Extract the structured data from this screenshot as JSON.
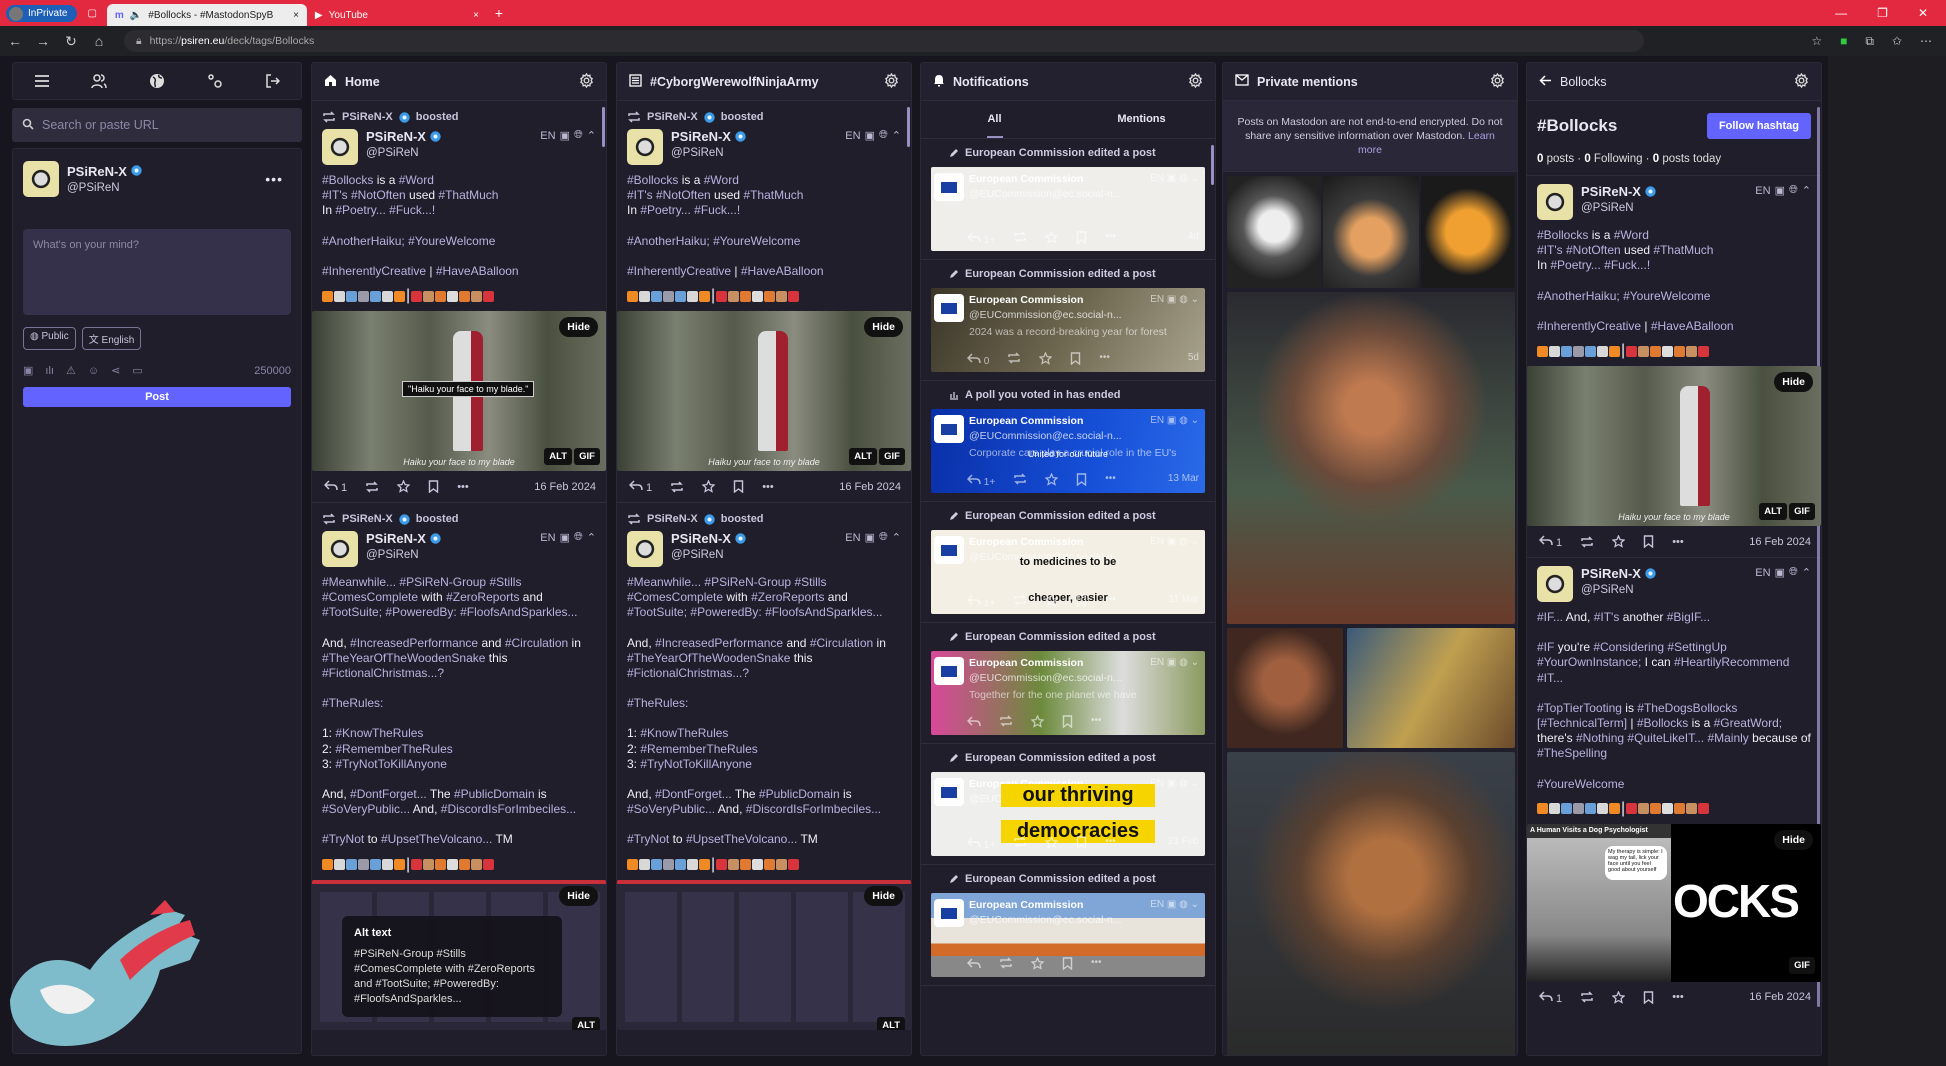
{
  "browser": {
    "inprivate": "InPrivate",
    "tabs": [
      {
        "title": "#Bollocks - #MastodonSpyB",
        "close": "×"
      },
      {
        "title": "YouTube",
        "close": "×"
      }
    ],
    "new_tab": "+",
    "url_prefix": "https://",
    "url_domain": "psiren.eu",
    "url_path": "/deck/tags/Bollocks"
  },
  "sidebar": {
    "search_placeholder": "Search or paste URL",
    "profile": {
      "name": "PSiReN-X",
      "handle": "@PSiReN"
    },
    "compose": {
      "placeholder": "What's on your mind?",
      "visibility": "Public",
      "language": "English",
      "counter": "250000",
      "post": "Post"
    }
  },
  "colors": {
    "accent": "#6364ff",
    "hashtag": "#b9b2e0",
    "titlebar": "#e3293f"
  },
  "columns": {
    "home": {
      "title": "Home"
    },
    "cyborg": {
      "title": "#CyborgWerewolfNinjaArmy"
    },
    "notifications": {
      "title": "Notifications",
      "tabs": [
        "All",
        "Mentions"
      ],
      "items": [
        {
          "label": "European Commission edited a post",
          "icon": "pencil-icon",
          "name": "European Commission",
          "handle": "@EUCommission@ec.social-n...",
          "excerpt": "",
          "meta": "EN",
          "replies": "1+",
          "date": "4d",
          "bg": "#efeeea",
          "overlay": []
        },
        {
          "label": "European Commission edited a post",
          "icon": "pencil-icon",
          "name": "European Commission",
          "handle": "@EUCommission@ec.social-n...",
          "excerpt": "2024 was a record-breaking year for forest",
          "meta": "EN",
          "replies": "0",
          "date": "5d",
          "bg": "linear-gradient(120deg,#3b3528,#6d6750 50%,#a9a48e)",
          "overlay": []
        },
        {
          "label": "A poll you voted in has ended",
          "icon": "poll-icon",
          "name": "European Commission",
          "handle": "@EUCommission@ec.social-n...",
          "excerpt": "Corporate cars play a crucial role in the EU's",
          "meta": "EN",
          "replies": "1+",
          "date": "13 Mar",
          "bg": "linear-gradient(100deg,#0a2fa8,#1650d8 60%,#2a6ae8)",
          "overlay": [
            "United for our future"
          ]
        },
        {
          "label": "European Commission edited a post",
          "icon": "pencil-icon",
          "name": "European Commission",
          "handle": "@EUCommission@ec.social-n...",
          "excerpt": "",
          "meta": "EN",
          "replies": "1+",
          "date": "11 Mar",
          "bg": "#f3efe4",
          "overlay": [
            "to medicines to be",
            "cheaper, easier"
          ]
        },
        {
          "label": "European Commission edited a post",
          "icon": "pencil-icon",
          "name": "European Commission",
          "handle": "@EUCommission@ec.social-n...",
          "excerpt": "Together for the one planet we have",
          "meta": "EN",
          "replies": "",
          "date": "",
          "bg": "linear-gradient(90deg,#d9489a,#6c8a3c 40%,#ddd 70%,#8a9a60)",
          "overlay": []
        },
        {
          "label": "European Commission edited a post",
          "icon": "pencil-icon",
          "name": "European Commission",
          "handle": "@EUCommission@ec.social-n...",
          "excerpt": "",
          "meta": "EN",
          "replies": "1+",
          "date": "21 Feb",
          "bg": "#eeeeec",
          "overlay": [
            "our thriving",
            "democracies"
          ]
        },
        {
          "label": "European Commission edited a post",
          "icon": "pencil-icon",
          "name": "European Commission",
          "handle": "@EUCommission@ec.social-n...",
          "excerpt": "",
          "meta": "EN",
          "replies": "",
          "date": "",
          "bg": "linear-gradient(180deg,#7fa6d6 0 30%,#e8e4dc 30%,#e8e4dc 60%,#d26a2a 60% 75%,#888 75%)",
          "overlay": []
        }
      ]
    },
    "private": {
      "title": "Private mentions",
      "notice": "Posts on Mastodon are not end-to-end encrypted. Do not share any sensitive information over Mastodon.",
      "learn_more": "Learn more"
    },
    "bollocks": {
      "title": "Bollocks",
      "hashtag": "#Bollocks",
      "follow": "Follow hashtag",
      "stats": {
        "posts": "0",
        "posts_label": " posts · ",
        "following": "0",
        "following_label": " Following · ",
        "today": "0",
        "today_label": " posts today"
      }
    }
  },
  "posts": {
    "haiku": {
      "boosted_by": "PSiReN-X",
      "boosted_label": "boosted",
      "name": "PSiReN-X",
      "handle": "@PSiReN",
      "lang": "EN",
      "lines": [
        "#Bollocks is a #Word",
        "#IT's #NotOften used #ThatMuch",
        "In #Poetry... #Fuck...!",
        "",
        "#AnotherHaiku; #YoureWelcome",
        "",
        "#InherentlyCreative | #HaveABalloon"
      ],
      "media": {
        "hide": "Hide",
        "alt": "ALT",
        "gif": "GIF",
        "caption": "Haiku your face to my blade",
        "quote": "\"Haiku your face to my blade.\""
      },
      "replies": "1",
      "date": "16 Feb 2024"
    },
    "meanwhile": {
      "boosted_by": "PSiReN-X",
      "boosted_label": "boosted",
      "name": "PSiReN-X",
      "handle": "@PSiReN",
      "lang": "EN",
      "lines": [
        "#Meanwhile... #PSiReN-Group #Stills",
        "#ComesComplete with #ZeroReports and",
        "#TootSuite; #PoweredBy: #FloofsAndSparkles...",
        "",
        "And, #IncreasedPerformance and #Circulation in",
        "#TheYearOfTheWoodenSnake this",
        "#FictionalChristmas...?",
        "",
        "#TheRules:",
        "",
        "1: #KnowTheRules",
        "2: #RememberTheRules",
        "3: #TryNotToKillAnyone",
        "",
        "And, #DontForget... The #PublicDomain is",
        "#SoVeryPublic...  And, #DiscordIsForImbeciles...",
        "",
        "#TryNot to #UpsetTheVolcano... TM"
      ],
      "media": {
        "hide": "Hide",
        "alt": "ALT",
        "alt_title": "Alt text",
        "alt_text": "#PSiReN-Group #Stills #ComesComplete with #ZeroReports and #TootSuite; #PoweredBy: #FloofsAndSparkles..."
      }
    },
    "bigif": {
      "name": "PSiReN-X",
      "handle": "@PSiReN",
      "lang": "EN",
      "lines": [
        "#IF... And, #IT's another #BigIF...",
        "",
        "#IF you're #Considering #SettingUp",
        "#YourOwnInstance; I can #HeartilyRecommend",
        "#IT...",
        "",
        "#TopTierTooting is #TheDogsBollocks",
        "[#TechnicalTerm] | #Bollocks is a #GreatWord;",
        "there's #Nothing #QuiteLikeIT... #Mainly because of",
        "#TheSpelling",
        "",
        "#YoureWelcome"
      ],
      "media": {
        "hide": "Hide",
        "gif": "GIF",
        "comic_title": "A Human Visits a Dog Psychologist",
        "comic_bubble": "My therapy is simple: I wag my tail, lick your face until you feel good about yourself",
        "big_text": "OCKS"
      },
      "replies": "1",
      "date": "16 Feb 2024"
    }
  }
}
